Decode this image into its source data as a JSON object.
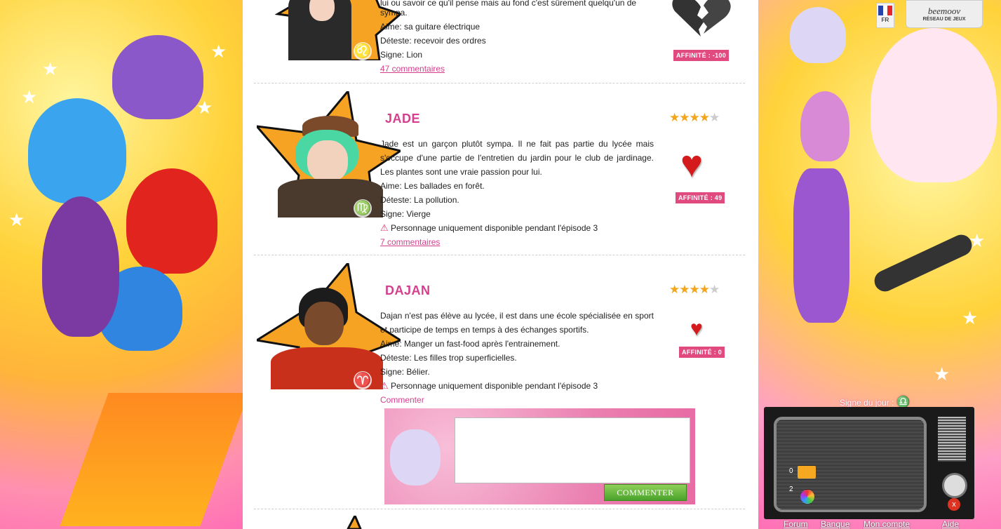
{
  "header": {
    "language": "FR",
    "network_logo": "beemoov",
    "network_subtitle": "RÉSEAU DE JEUX"
  },
  "characters": [
    {
      "name": "",
      "description_lines": [
        "lui ou savoir ce qu'il pense mais au fond c'est sûrement quelqu'un de",
        "sympa."
      ],
      "likes": "Aime: sa guitare électrique",
      "dislikes": "Déteste: recevoir des ordres",
      "sign": "Signe: Lion",
      "zodiac_symbol": "♌",
      "comments_link": "47 commentaires",
      "affinity": "AFFINITÉ : -100",
      "heart_icon": "broken-heart-icon"
    },
    {
      "name": "JADE",
      "rating": 4,
      "rating_max": 5,
      "description": "Jade est un garçon plutôt sympa. Il ne fait pas partie du lycée mais s'occupe d'une partie de l'entretien du jardin pour le club de jardinage. Les plantes sont une vraie passion pour lui.",
      "likes": "Aime: Les ballades en forêt.",
      "dislikes": "Déteste: La pollution.",
      "sign": "Signe: Vierge",
      "zodiac_symbol": "♍",
      "warning": "Personnage uniquement disponible pendant l'épisode 3",
      "comments_link": "7 commentaires",
      "affinity": "AFFINITÉ : 49",
      "heart_icon": "heart-icon"
    },
    {
      "name": "DAJAN",
      "rating": 4,
      "rating_max": 5,
      "description": "Dajan n'est pas élève au lycée, il est dans une école spécialisée en sport et participe de temps en temps à des échanges sportifs.",
      "likes": "Aime: Manger un fast-food après l'entrainement.",
      "dislikes": "Déteste: Les filles trop superficielles.",
      "sign": "Signe: Bélier.",
      "zodiac_symbol": "♈",
      "warning": "Personnage uniquement disponible pendant l'épisode 3",
      "comments_link": "Commenter",
      "affinity": "AFFINITÉ : 0",
      "heart_icon": "heart-icon"
    }
  ],
  "comment_form": {
    "textarea_value": "",
    "submit_label": "COMMENTER"
  },
  "sidebar": {
    "sign_of_day_label": "Signe du jour :",
    "sign_of_day_symbol": "♎",
    "tv": {
      "mail_count": "0",
      "gift_count": "2",
      "close_label": "x"
    }
  },
  "footer_nav": {
    "forum": "Forum",
    "bank": "Banque",
    "account": "Mon compte",
    "help": "Aide"
  },
  "colors": {
    "accent_pink": "#d43f8d",
    "affinity_bg": "#e04a7e",
    "heart_red": "#d41a1a",
    "star_gold": "#f3a51c",
    "button_green": "#4aa22a"
  }
}
